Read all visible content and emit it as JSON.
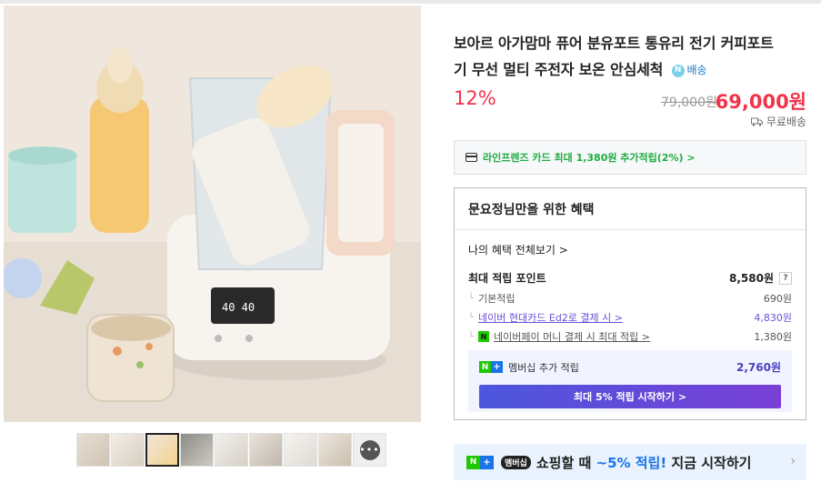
{
  "product": {
    "title_line1": "보아르 아가맘마 퓨어 분유포트 통유리 전기 커피포트",
    "title_line2": "기 무선 멀티 주전자 보온 안심세척",
    "delivery_badge": "배송",
    "delivery_badge_icon": "N",
    "discount": "12%",
    "original_price": "79,000원",
    "price": "69,000원",
    "shipping": "무료배송",
    "shipping_icon": "truck-icon"
  },
  "card_promo": {
    "text": "라인프렌즈 카드 최대 1,380원 추가적립(2%) >"
  },
  "benefits": {
    "title": "문요정님만을 위한 혜택",
    "view_all": "나의 혜택 전체보기 >",
    "max_label": "최대 적립 포인트",
    "max_value": "8,580원",
    "help": "?",
    "rows": [
      {
        "label": "기본적립",
        "value": "690원"
      },
      {
        "label": "네이버 현대카드 Ed2로 결제 시 >",
        "value": "4,830원"
      },
      {
        "label": "네이버페이 머니 결제 시 최대 적립 >",
        "value": "1,380원"
      }
    ],
    "npay_icon": "N",
    "membership": {
      "label": "멤버십 추가 적립",
      "value": "2,760원",
      "button": "최대 5% 적립 시작하기 >",
      "logo_n": "N",
      "logo_plus": "+"
    }
  },
  "banner": {
    "logo_n": "N",
    "logo_plus": "+",
    "tag": "멤버십",
    "text_pre": "쇼핑할 때 ",
    "text_hl": "~5% 적립!",
    "text_post": " 지금 시작하기",
    "chevron": "›"
  },
  "gallery": {
    "more_label": "•••"
  },
  "colors": {
    "sale_red": "#f0344a",
    "naver_green": "#1ec800",
    "membership_purple": "#6c4fd6"
  }
}
